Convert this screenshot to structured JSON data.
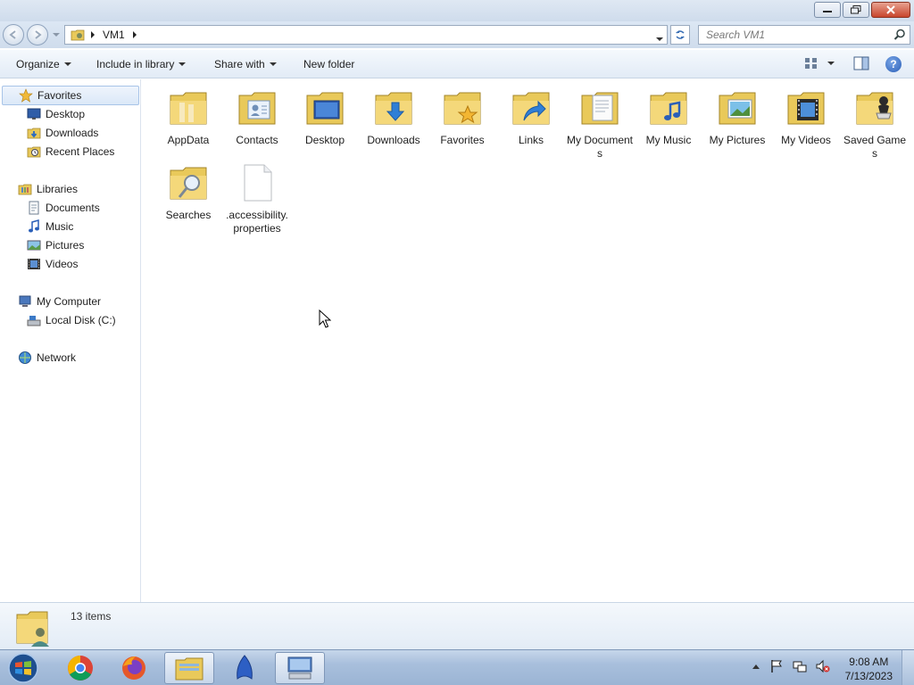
{
  "window": {
    "address": {
      "crumb": "VM1"
    },
    "search": {
      "placeholder": "Search VM1"
    }
  },
  "toolbar": {
    "organize": "Organize",
    "include_in_library": "Include in library",
    "share_with": "Share with",
    "new_folder": "New folder"
  },
  "nav": {
    "favorites": "Favorites",
    "desktop": "Desktop",
    "downloads": "Downloads",
    "recent_places": "Recent Places",
    "libraries": "Libraries",
    "documents": "Documents",
    "music": "Music",
    "pictures": "Pictures",
    "videos": "Videos",
    "my_computer": "My Computer",
    "local_disk": "Local Disk (C:)",
    "network": "Network"
  },
  "items": [
    {
      "label": "AppData",
      "icon": "folder-icon"
    },
    {
      "label": "Contacts",
      "icon": "contacts-folder-icon"
    },
    {
      "label": "Desktop",
      "icon": "desktop-folder-icon"
    },
    {
      "label": "Downloads",
      "icon": "downloads-folder-icon"
    },
    {
      "label": "Favorites",
      "icon": "favorites-folder-icon"
    },
    {
      "label": "Links",
      "icon": "links-folder-icon"
    },
    {
      "label": "My Documents",
      "icon": "documents-folder-icon"
    },
    {
      "label": "My Music",
      "icon": "music-folder-icon"
    },
    {
      "label": "My Pictures",
      "icon": "pictures-folder-icon"
    },
    {
      "label": "My Videos",
      "icon": "videos-folder-icon"
    },
    {
      "label": "Saved Games",
      "icon": "saved-games-folder-icon"
    },
    {
      "label": "Searches",
      "icon": "searches-folder-icon"
    },
    {
      "label": ".accessibility.properties",
      "icon": "file-icon"
    }
  ],
  "status": {
    "count_text": "13 items"
  },
  "taskbar": {
    "time": "9:08 AM",
    "date": "7/13/2023"
  }
}
